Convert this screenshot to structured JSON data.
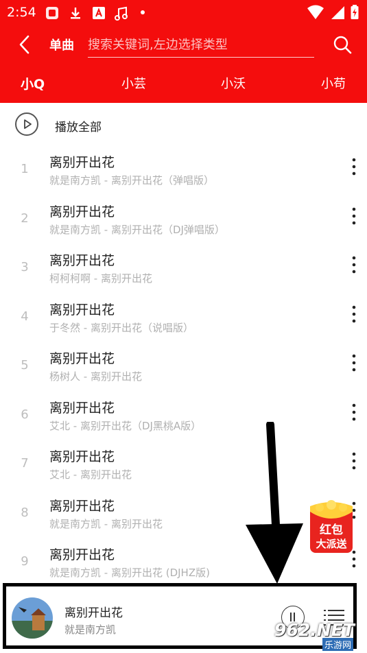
{
  "status": {
    "time": "2:54"
  },
  "header": {
    "type_label": "单曲",
    "search_placeholder": "搜索关键词,左边选择类型"
  },
  "tabs": [
    {
      "label": "小Q",
      "active": true
    },
    {
      "label": "小芸",
      "active": false
    },
    {
      "label": "小沃",
      "active": false
    },
    {
      "label": "小苟",
      "active": false
    }
  ],
  "play_all": {
    "label": "播放全部"
  },
  "songs": [
    {
      "index": "1",
      "title": "离别开出花",
      "subtitle": "就是南方凯 - 离别开出花（弹唱版）"
    },
    {
      "index": "2",
      "title": "离别开出花",
      "subtitle": "就是南方凯 - 离别开出花（DJ弹唱版）"
    },
    {
      "index": "3",
      "title": "离别开出花",
      "subtitle": "柯柯柯啊 - 离别开出花"
    },
    {
      "index": "4",
      "title": "离别开出花",
      "subtitle": "于冬然 - 离别开出花（说唱版）"
    },
    {
      "index": "5",
      "title": "离别开出花",
      "subtitle": "杨树人 - 离别开出花"
    },
    {
      "index": "6",
      "title": "离别开出花",
      "subtitle": "艾北 - 离别开出花（DJ黑桃A版）"
    },
    {
      "index": "7",
      "title": "离别开出花",
      "subtitle": "艾北 - 离别开出花"
    },
    {
      "index": "8",
      "title": "离别开出花",
      "subtitle": "就是南方凯 - 离别开出花"
    },
    {
      "index": "9",
      "title": "离别开出花",
      "subtitle": "就是南方凯 - 离别开出花 (DJHZ版)"
    }
  ],
  "player": {
    "title": "离别开出花",
    "artist": "就是南方凯"
  },
  "red_packet": {
    "line1": "红包",
    "line2": "大派送"
  },
  "watermark": {
    "main": "962.NET",
    "sub": "乐游网"
  },
  "colors": {
    "accent": "#f40d0d",
    "subtitle": "#b0b0b0",
    "index": "#bdbdbd"
  }
}
